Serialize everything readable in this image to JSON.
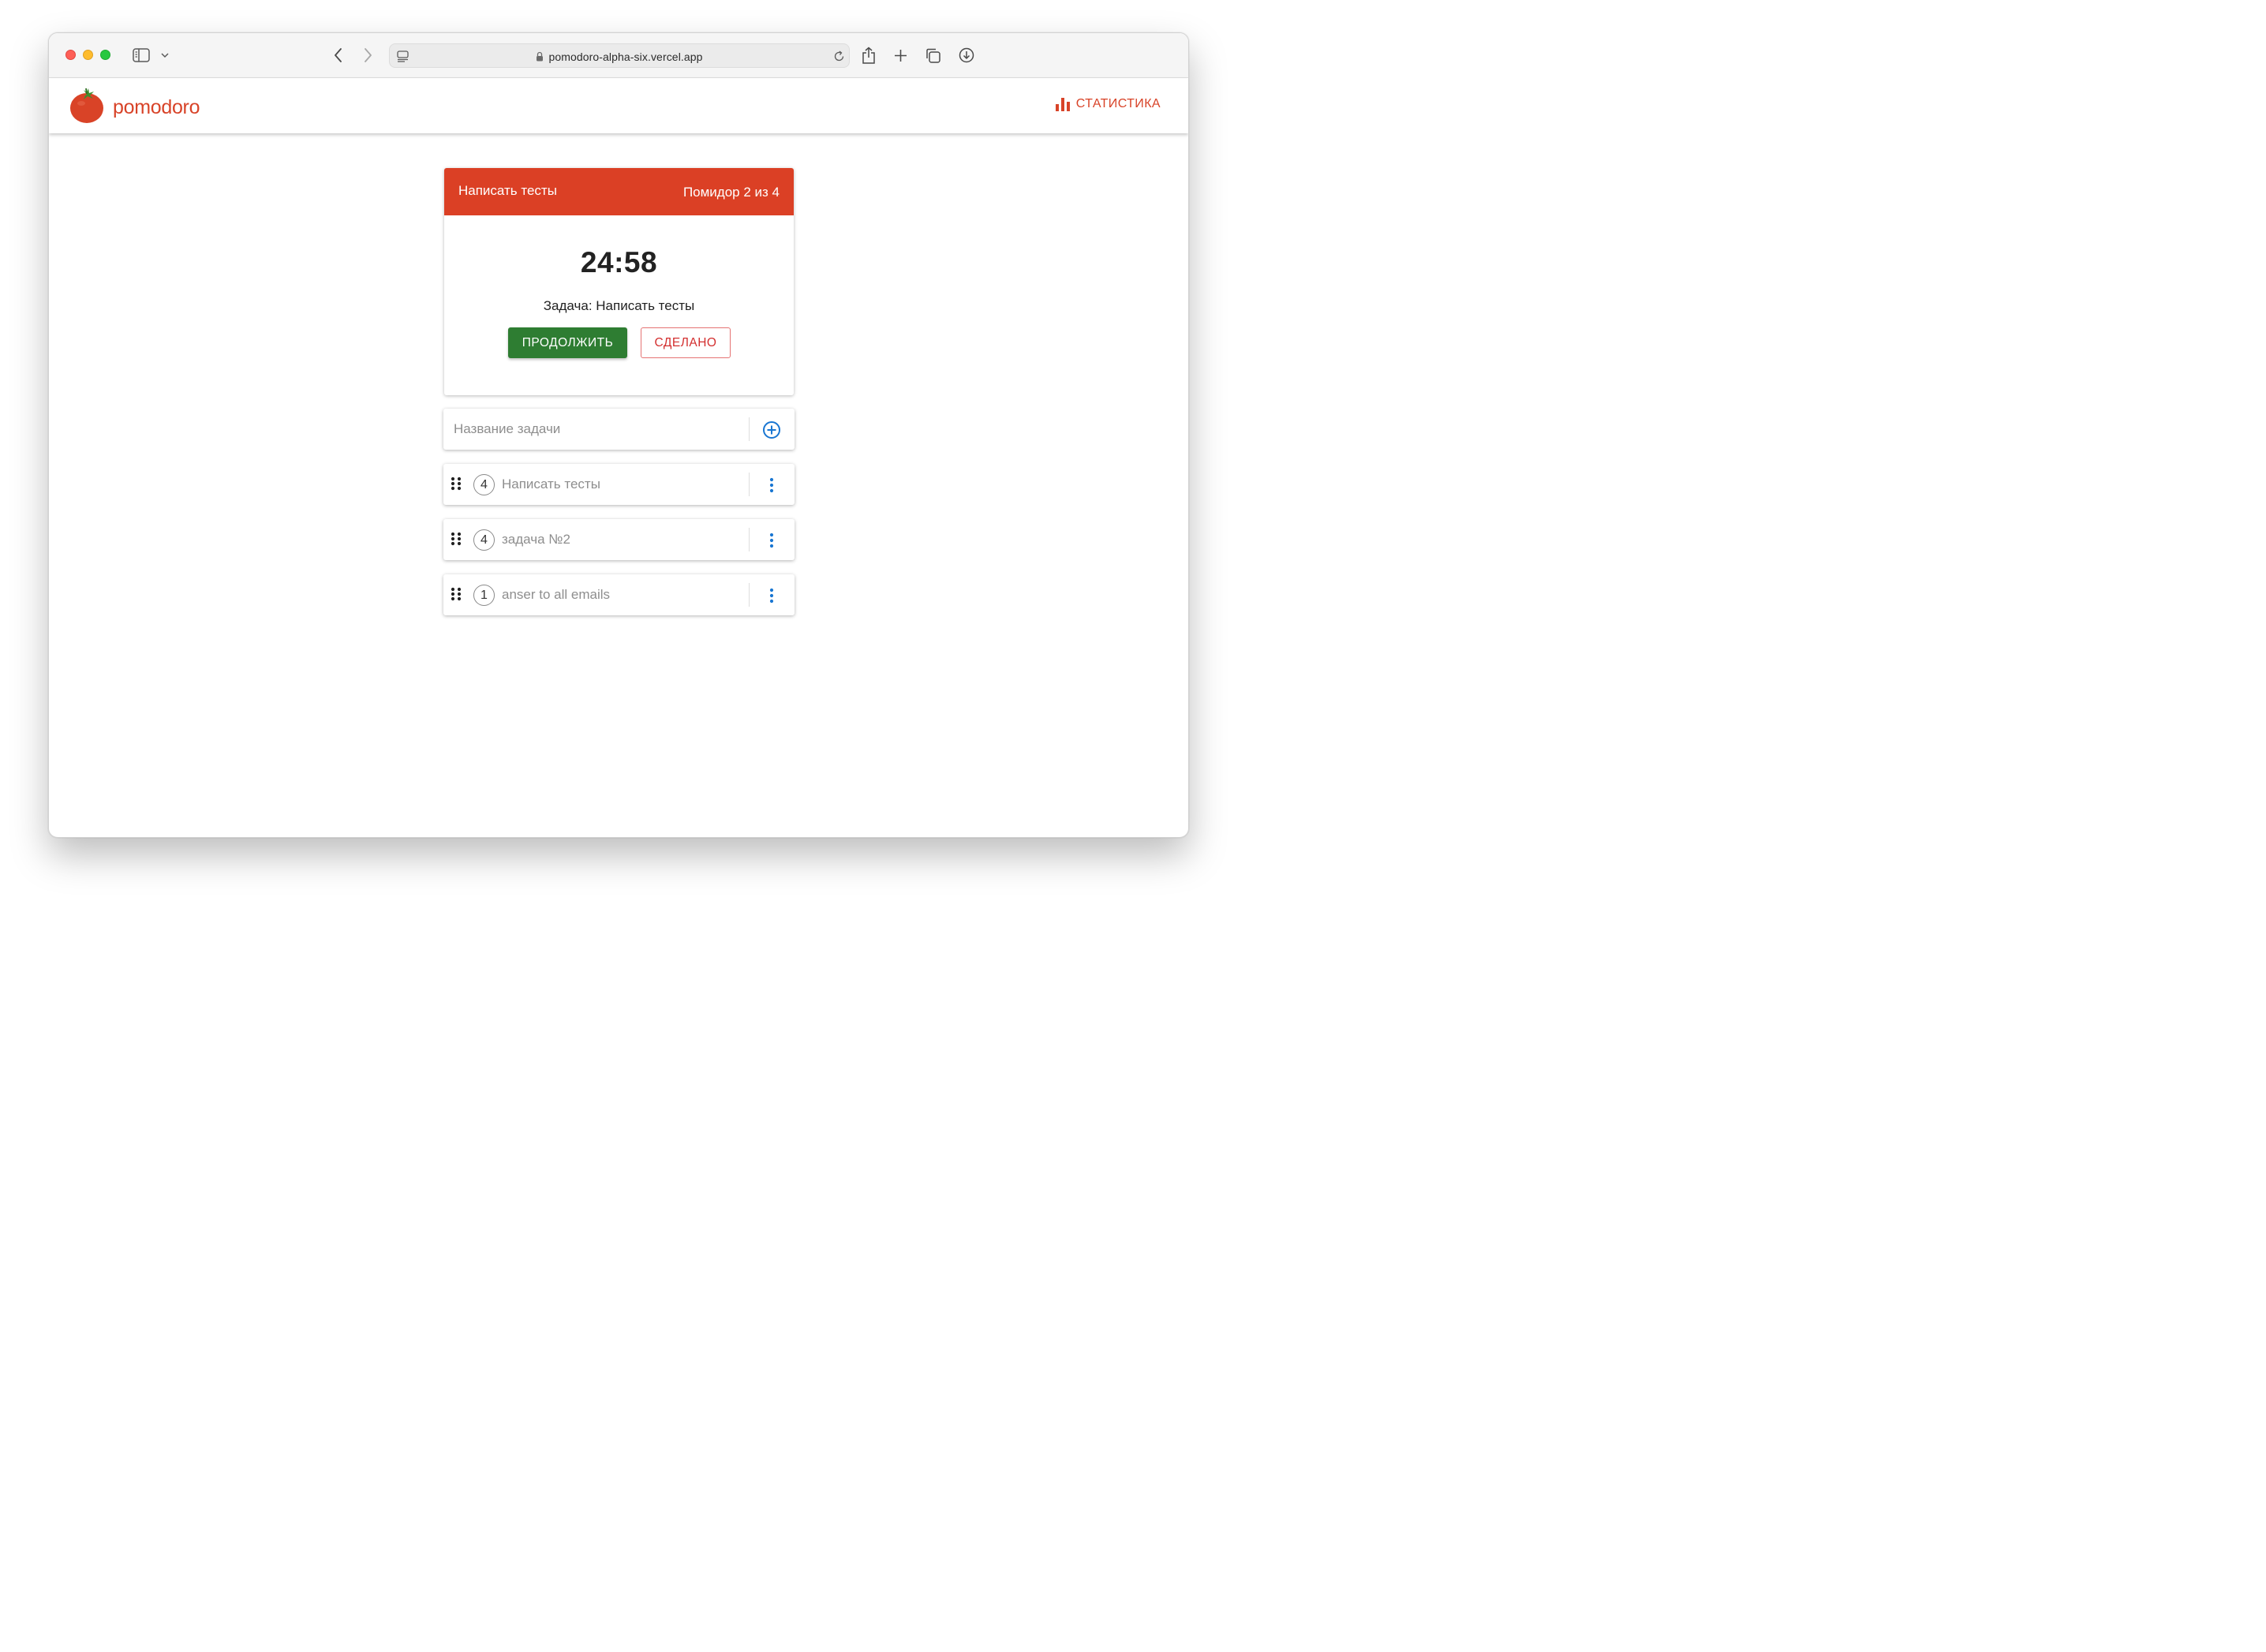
{
  "browser": {
    "url": "pomodoro-alpha-six.vercel.app",
    "icons": {
      "sidebar": "sidebar-icon",
      "back": "chevron-left-icon",
      "forward": "chevron-right-icon",
      "reader": "reader-icon",
      "lock": "lock-icon",
      "reload": "reload-icon",
      "share": "share-icon",
      "new_tab": "plus-icon",
      "tabs": "tabs-overview-icon",
      "downloads": "download-icon"
    }
  },
  "header": {
    "brand_name": "pomodoro",
    "stats_label": "СТАТИСТИКА"
  },
  "timer": {
    "task_title": "Написать тесты",
    "pomodoro_counter": "Помидор 2 из 4",
    "time": "24:58",
    "task_line": "Задача: Написать тесты",
    "continue_label": "ПРОДОЛЖИТЬ",
    "done_label": "СДЕЛАНО"
  },
  "new_task": {
    "placeholder": "Название задачи"
  },
  "tasks": [
    {
      "count": "4",
      "name": "Написать тесты"
    },
    {
      "count": "4",
      "name": "задача №2"
    },
    {
      "count": "1",
      "name": "anser to all emails"
    }
  ],
  "colors": {
    "brand_red": "#d84328",
    "header_red": "#db4025",
    "continue_green": "#2e7d32",
    "done_red": "#d32f2f",
    "action_blue": "#1976d2"
  }
}
